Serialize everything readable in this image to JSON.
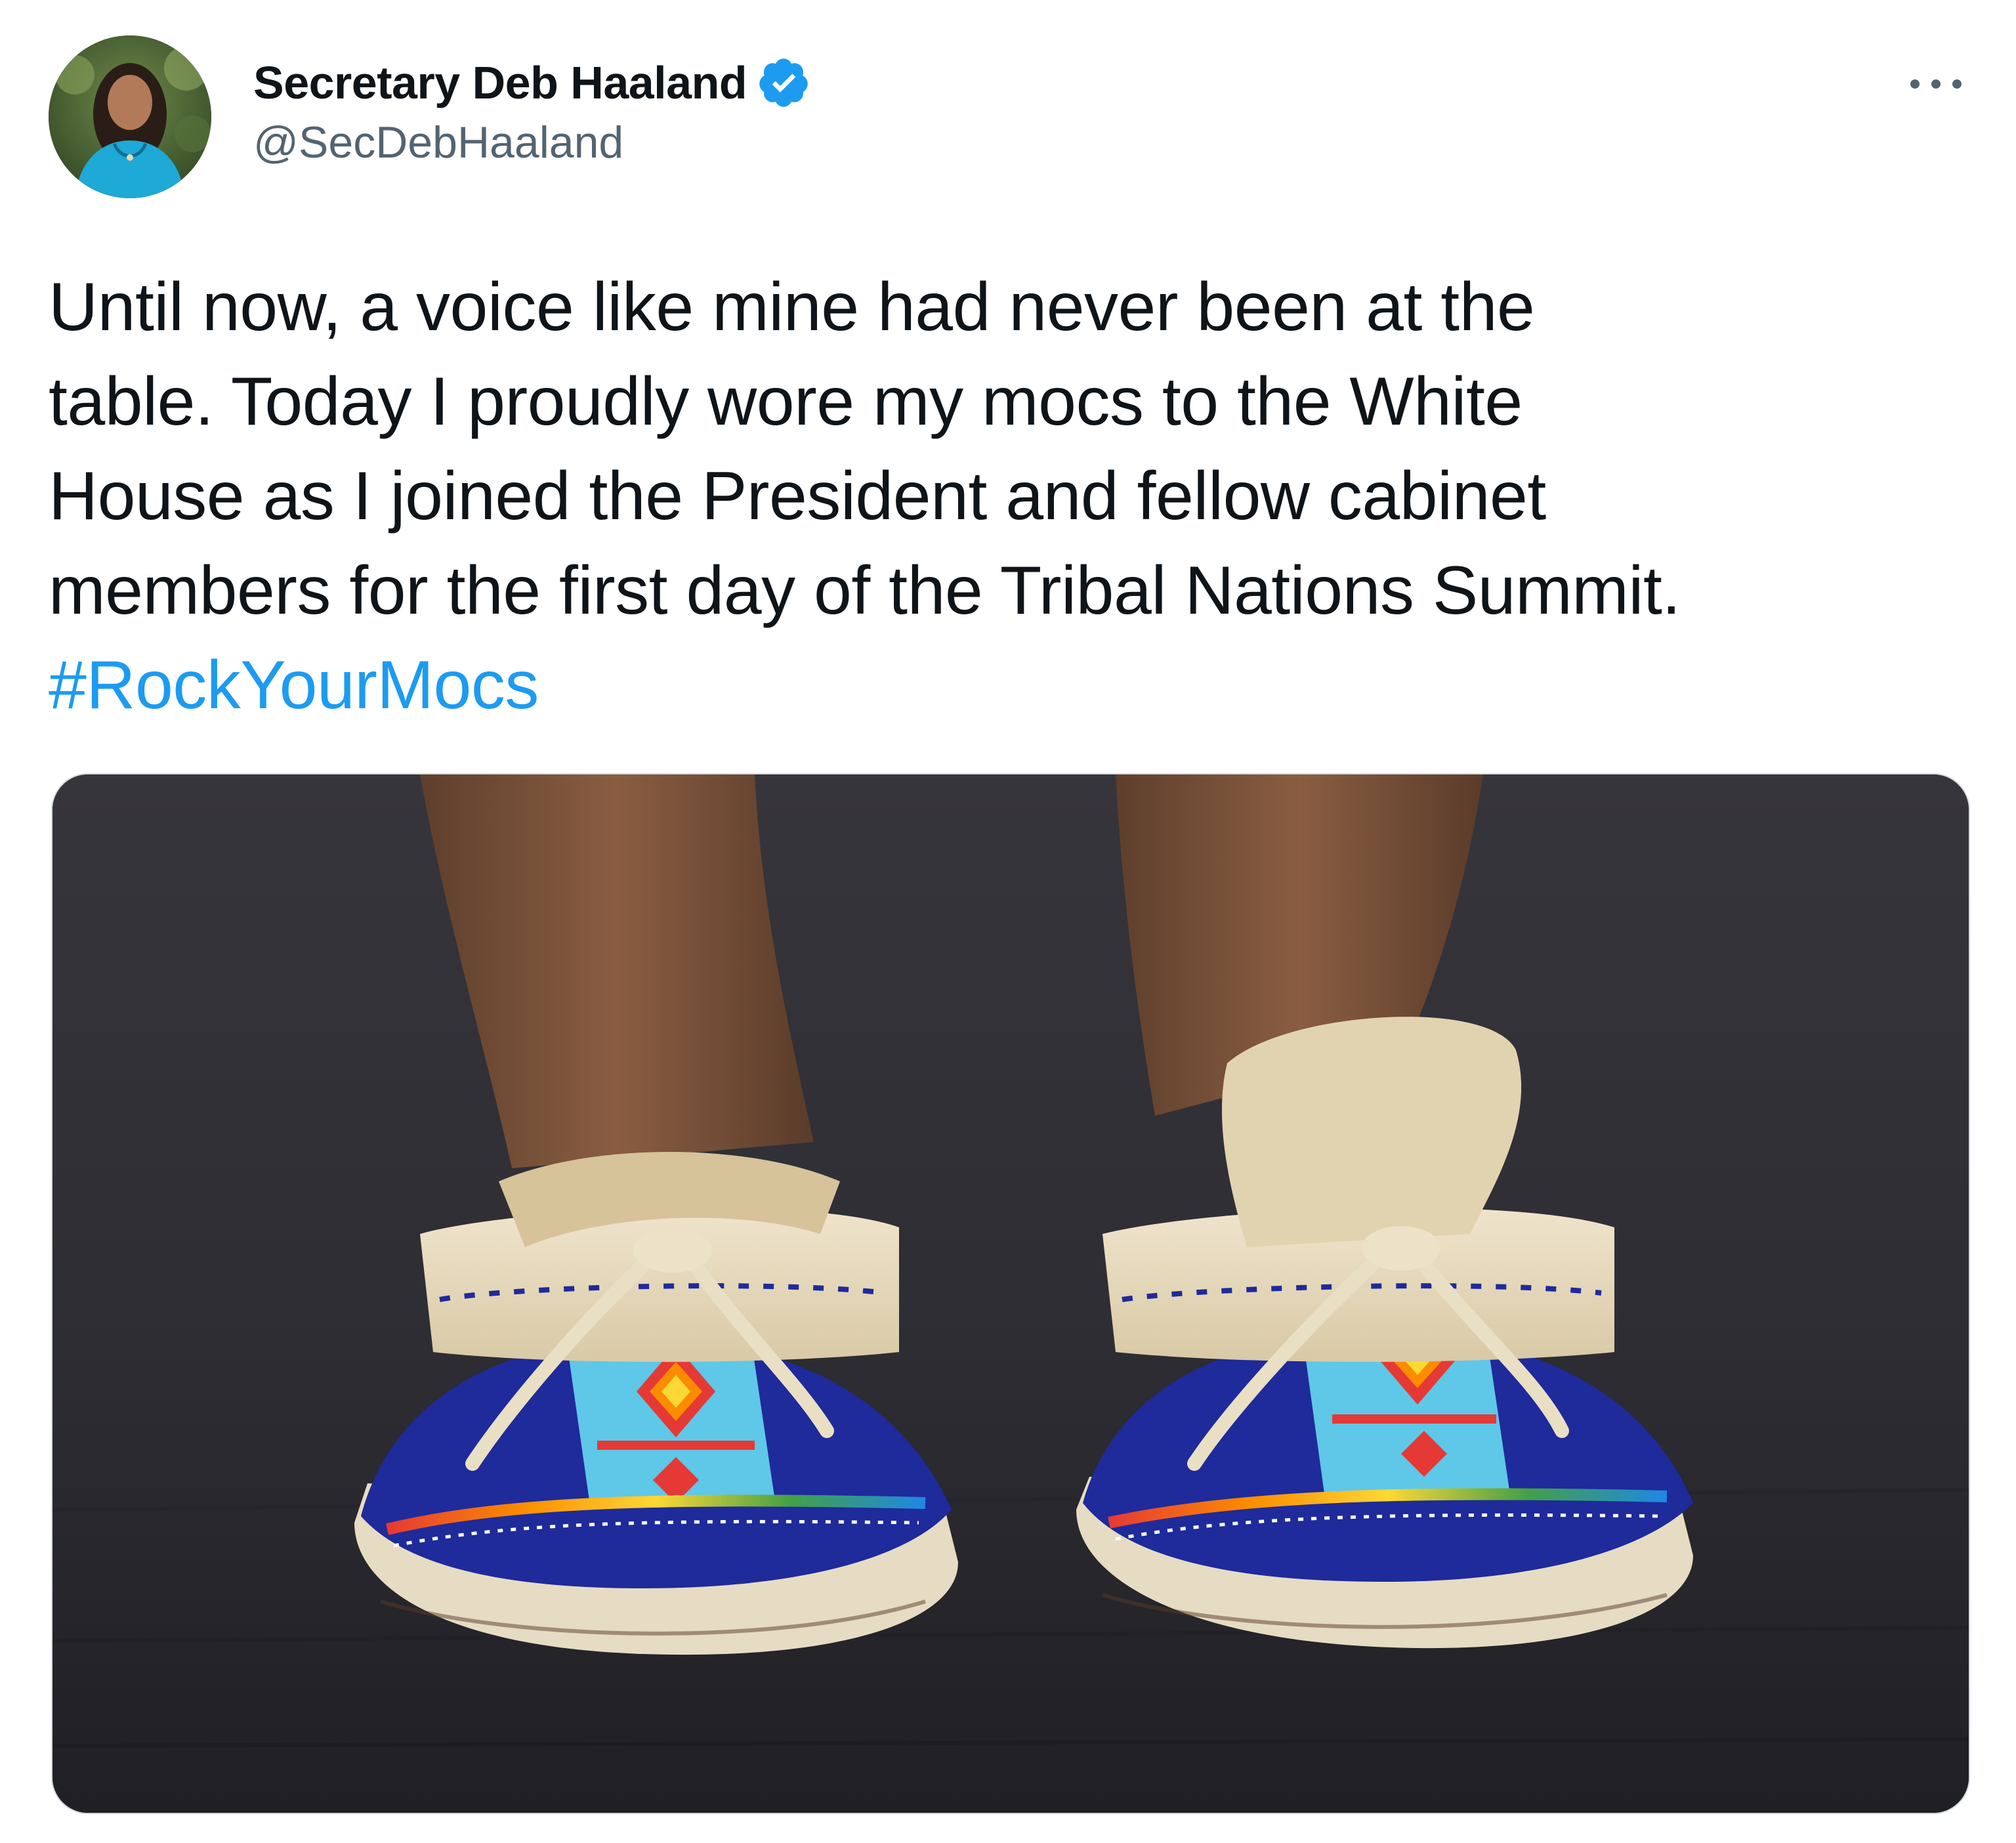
{
  "tweet": {
    "author": {
      "display_name": "Secretary Deb Haaland",
      "handle": "@SecDebHaaland",
      "verified": true,
      "avatar_icon": "profile-photo"
    },
    "more_icon": "more-horizontal-icon",
    "text_lines": [
      "Until now, a voice like mine had never been at the",
      "table. Today I proudly wore my mocs to the White",
      "House as I joined the President and fellow cabinet",
      "members for the first day of the Tribal Nations Summit."
    ],
    "hashtag": "#RockYourMocs",
    "media": {
      "type": "photo"
    }
  },
  "colors": {
    "text": "#0f1419",
    "secondary_text": "#536471",
    "link": "#1d9bf0",
    "verified_badge": "#1d9bf0"
  }
}
